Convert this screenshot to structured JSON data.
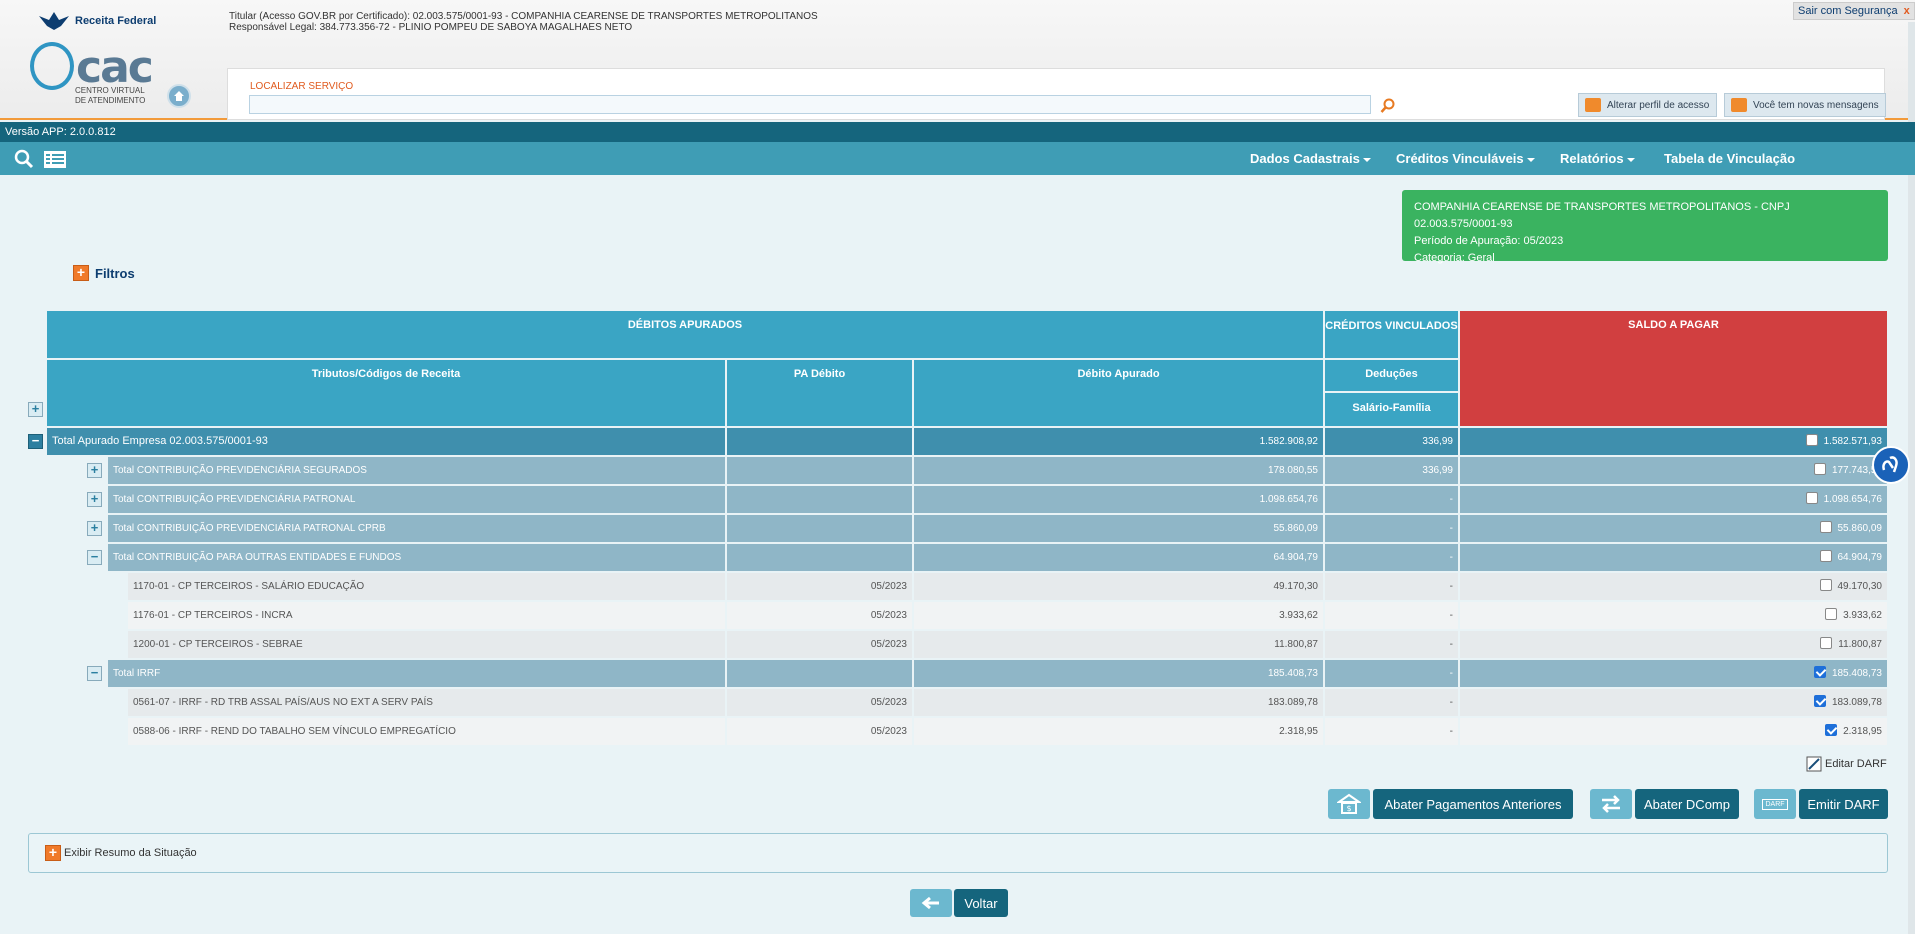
{
  "header": {
    "receita_label": "Receita Federal",
    "ecac_big": "cac",
    "ecac_sub": "CENTRO VIRTUAL\nDE ATENDIMENTO",
    "titular_line1": "Titular (Acesso GOV.BR por Certificado): 02.003.575/0001-93 - COMPANHIA CEARENSE DE TRANSPORTES METROPOLITANOS",
    "titular_line2": "Responsável Legal: 384.773.356-72 - PLINIO POMPEU DE SABOYA MAGALHAES NETO",
    "sair": "Sair com Segurança",
    "sair_x": "x",
    "search_label": "LOCALIZAR SERVIÇO",
    "search_value": "",
    "alterar_perfil": "Alterar perfil de acesso",
    "mensagens": "Você tem novas mensagens"
  },
  "version": "Versão APP: 2.0.0.812",
  "nav": {
    "dados": "Dados Cadastrais",
    "creditos": "Créditos Vinculáveis",
    "relatorios": "Relatórios",
    "tabela": "Tabela de Vinculação"
  },
  "info": {
    "line1": "COMPANHIA CEARENSE DE TRANSPORTES METROPOLITANOS - CNPJ 02.003.575/0001-93",
    "line2": "Período de Apuração: 05/2023",
    "line3": "Categoria: Geral"
  },
  "filtros": "Filtros",
  "table": {
    "debitos_apurados": "DÉBITOS APURADOS",
    "creditos_vinculados": "CRÉDITOS VINCULADOS",
    "saldo_a_pagar": "SALDO A PAGAR",
    "tributos": "Tributos/Códigos de Receita",
    "pa_debito": "PA Débito",
    "debito_apurado": "Débito Apurado",
    "deducoes": "Deduções",
    "salario_familia": "Salário-Família",
    "rows": [
      {
        "label": "Total Apurado Empresa 02.003.575/0001-93",
        "pa": "",
        "debito": "1.582.908,92",
        "credito": "336,99",
        "saldo": "1.582.571,93",
        "checked": false
      },
      {
        "label": "Total CONTRIBUIÇÃO PREVIDENCIÁRIA SEGURADOS",
        "pa": "",
        "debito": "178.080,55",
        "credito": "336,99",
        "saldo": "177.743,56",
        "checked": false
      },
      {
        "label": "Total CONTRIBUIÇÃO PREVIDENCIÁRIA PATRONAL",
        "pa": "",
        "debito": "1.098.654,76",
        "credito": "-",
        "saldo": "1.098.654,76",
        "checked": false
      },
      {
        "label": "Total CONTRIBUIÇÃO PREVIDENCIÁRIA PATRONAL CPRB",
        "pa": "",
        "debito": "55.860,09",
        "credito": "-",
        "saldo": "55.860,09",
        "checked": false
      },
      {
        "label": "Total CONTRIBUIÇÃO PARA OUTRAS ENTIDADES E FUNDOS",
        "pa": "",
        "debito": "64.904,79",
        "credito": "-",
        "saldo": "64.904,79",
        "checked": false
      },
      {
        "label": "1170-01 - CP TERCEIROS - SALÁRIO EDUCAÇÃO",
        "pa": "05/2023",
        "debito": "49.170,30",
        "credito": "-",
        "saldo": "49.170,30",
        "checked": false
      },
      {
        "label": "1176-01 - CP TERCEIROS - INCRA",
        "pa": "05/2023",
        "debito": "3.933,62",
        "credito": "-",
        "saldo": "3.933,62",
        "checked": false
      },
      {
        "label": "1200-01 - CP TERCEIROS - SEBRAE",
        "pa": "05/2023",
        "debito": "11.800,87",
        "credito": "-",
        "saldo": "11.800,87",
        "checked": false
      },
      {
        "label": "Total IRRF",
        "pa": "",
        "debito": "185.408,73",
        "credito": "-",
        "saldo": "185.408,73",
        "checked": true
      },
      {
        "label": "0561-07 - IRRF - RD TRB ASSAL PAÍS/AUS NO EXT A SERV PAÍS",
        "pa": "05/2023",
        "debito": "183.089,78",
        "credito": "-",
        "saldo": "183.089,78",
        "checked": true
      },
      {
        "label": "0588-06 - IRRF - REND DO TABALHO SEM VÍNCULO EMPREGATÍCIO",
        "pa": "05/2023",
        "debito": "2.318,95",
        "credito": "-",
        "saldo": "2.318,95",
        "checked": true
      }
    ]
  },
  "actions": {
    "editar_darf": "Editar DARF",
    "abater_pagamentos": "Abater Pagamentos Anteriores",
    "abater_dcomp": "Abater DComp",
    "emitir_darf": "Emitir DARF",
    "darf_icon_text": "DARF",
    "exibir_resumo": "Exibir Resumo da Situação",
    "voltar": "Voltar"
  }
}
